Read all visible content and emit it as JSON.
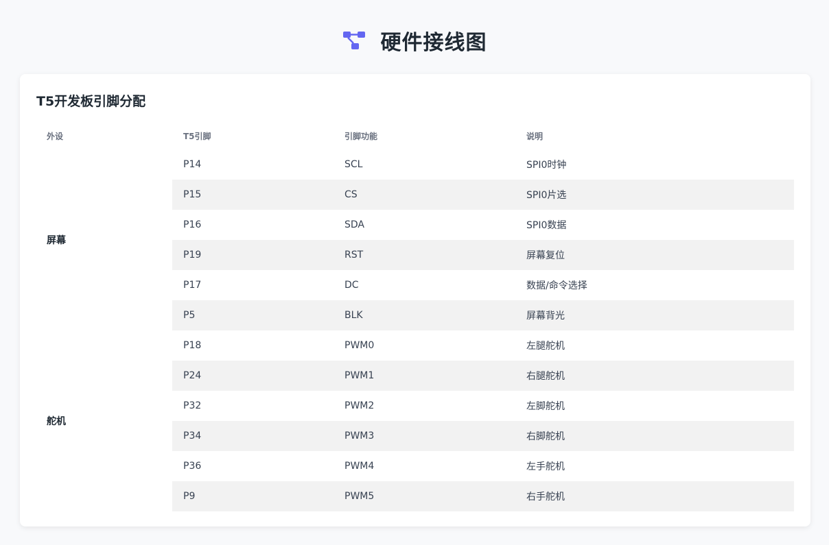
{
  "header": {
    "title": "硬件接线图",
    "icon": "diagram-project-icon",
    "icon_color": "#6366f1"
  },
  "card": {
    "title": "T5开发板引脚分配"
  },
  "table": {
    "columns": [
      "外设",
      "T5引脚",
      "引脚功能",
      "说明"
    ],
    "groups": [
      {
        "name": "屏幕",
        "rows": [
          {
            "pin": "P14",
            "function": "SCL",
            "description": "SPI0时钟"
          },
          {
            "pin": "P15",
            "function": "CS",
            "description": "SPI0片选"
          },
          {
            "pin": "P16",
            "function": "SDA",
            "description": "SPI0数据"
          },
          {
            "pin": "P19",
            "function": "RST",
            "description": "屏幕复位"
          },
          {
            "pin": "P17",
            "function": "DC",
            "description": "数据/命令选择"
          },
          {
            "pin": "P5",
            "function": "BLK",
            "description": "屏幕背光"
          }
        ]
      },
      {
        "name": "舵机",
        "rows": [
          {
            "pin": "P18",
            "function": "PWM0",
            "description": "左腿舵机"
          },
          {
            "pin": "P24",
            "function": "PWM1",
            "description": "右腿舵机"
          },
          {
            "pin": "P32",
            "function": "PWM2",
            "description": "左脚舵机"
          },
          {
            "pin": "P34",
            "function": "PWM3",
            "description": "右脚舵机"
          },
          {
            "pin": "P36",
            "function": "PWM4",
            "description": "左手舵机"
          },
          {
            "pin": "P9",
            "function": "PWM5",
            "description": "右手舵机"
          }
        ]
      }
    ]
  },
  "colors": {
    "page_background": "#f8f9fb",
    "card_background": "#ffffff",
    "stripe": "#f2f2f2",
    "accent": "#6366f1"
  }
}
